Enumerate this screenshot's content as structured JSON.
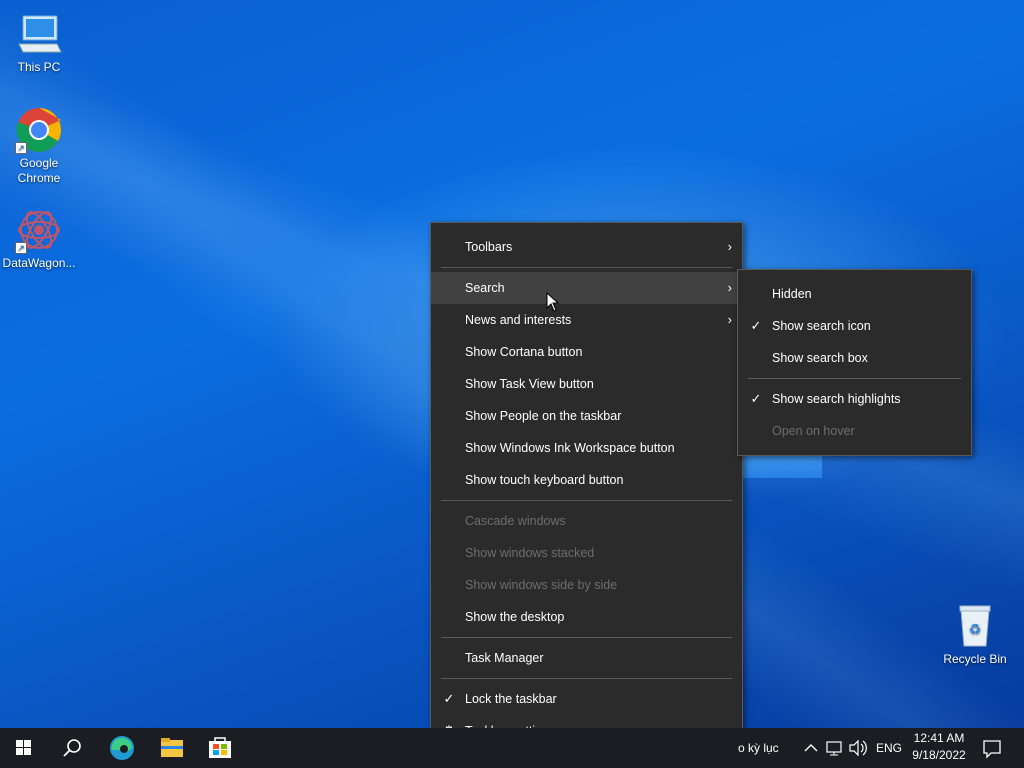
{
  "desktop": {
    "icons": [
      {
        "label": "This PC",
        "icon": "this-pc-icon"
      },
      {
        "label": "Google Chrome",
        "icon": "chrome-icon"
      },
      {
        "label": "DataWagon...",
        "icon": "datawagon-icon"
      },
      {
        "label": "Recycle Bin",
        "icon": "recycle-bin-icon"
      }
    ]
  },
  "context_menu": {
    "items": [
      {
        "label": "Toolbars",
        "submenu": true
      },
      {
        "label": "Search",
        "submenu": true,
        "highlighted": true
      },
      {
        "label": "News and interests",
        "submenu": true
      },
      {
        "label": "Show Cortana button"
      },
      {
        "label": "Show Task View button"
      },
      {
        "label": "Show People on the taskbar"
      },
      {
        "label": "Show Windows Ink Workspace button"
      },
      {
        "label": "Show touch keyboard button"
      },
      {
        "label": "Cascade windows",
        "disabled": true
      },
      {
        "label": "Show windows stacked",
        "disabled": true
      },
      {
        "label": "Show windows side by side",
        "disabled": true
      },
      {
        "label": "Show the desktop"
      },
      {
        "label": "Task Manager"
      },
      {
        "label": "Lock the taskbar",
        "checked": true
      },
      {
        "label": "Taskbar settings",
        "icon": "gear-icon"
      }
    ]
  },
  "search_submenu": {
    "items": [
      {
        "label": "Hidden"
      },
      {
        "label": "Show search icon",
        "checked": true
      },
      {
        "label": "Show search box"
      },
      {
        "label": "Show search highlights",
        "checked": true
      },
      {
        "label": "Open on hover",
        "disabled": true
      }
    ]
  },
  "taskbar": {
    "apps": [
      "start-icon",
      "search-icon",
      "edge-icon",
      "file-explorer-icon",
      "store-icon"
    ],
    "weather_text": "o kỳ lục",
    "language": "ENG",
    "time": "12:41 AM",
    "date": "9/18/2022"
  },
  "colors": {
    "menu_bg": "#2b2b2b",
    "menu_hover": "#414141",
    "disabled_text": "#6d6d6d",
    "taskbar_bg": "#1c1d22"
  }
}
